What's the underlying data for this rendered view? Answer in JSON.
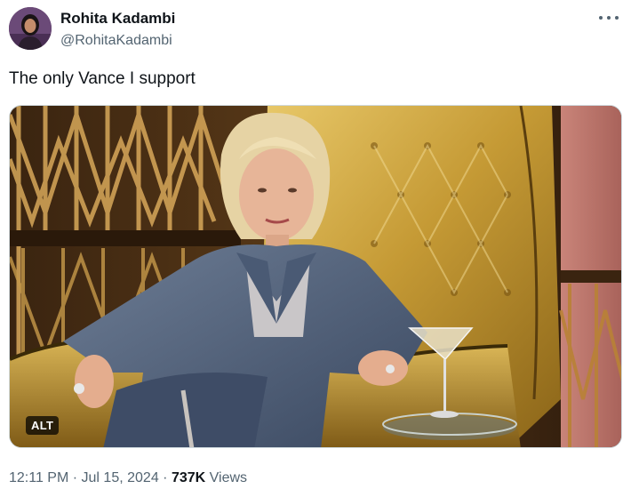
{
  "author": {
    "display_name": "Rohita Kadambi",
    "handle": "@RohitaKadambi",
    "avatar_icon": "profile-photo"
  },
  "menu_icon": "more-horizontal-icon",
  "tweet": {
    "text": "The only Vance I support"
  },
  "media": {
    "alt_badge": "ALT",
    "photo_description_icon": "photo"
  },
  "meta": {
    "time": "12:11 PM",
    "separator": "·",
    "date": "Jul 15, 2024",
    "views_count": "737K",
    "views_label": "Views"
  },
  "colors": {
    "text_primary": "#0f1419",
    "text_secondary": "#536471",
    "border": "#cfd9de",
    "gold": "#c9a13b"
  }
}
